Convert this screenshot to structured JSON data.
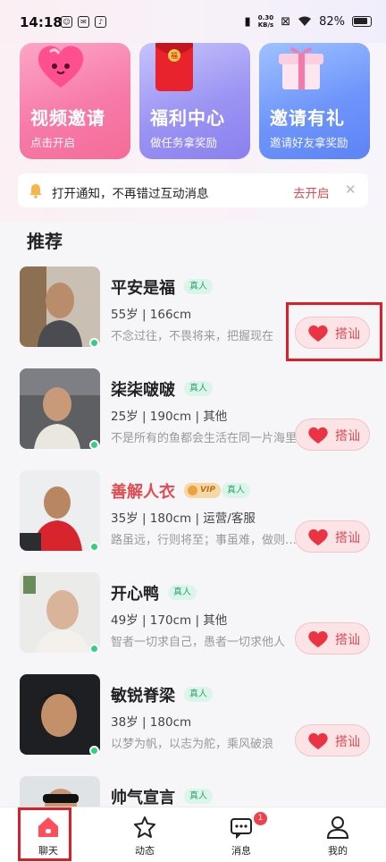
{
  "status_bar": {
    "time": "14:18",
    "net_speed_value": "0.30",
    "net_speed_unit": "KB/s",
    "battery": "82%"
  },
  "feature_cards": [
    {
      "title": "视频邀请",
      "subtitle": "点击开启"
    },
    {
      "title": "福利中心",
      "subtitle": "做任务拿奖励"
    },
    {
      "title": "邀请有礼",
      "subtitle": "邀请好友拿奖励"
    }
  ],
  "notice": {
    "text": "打开通知，不再错过互动消息",
    "action": "去开启",
    "close": "✕"
  },
  "section_title": "推荐",
  "verified_label": "真人",
  "vip_label": "VIP",
  "chat_button_label": "搭讪",
  "users": [
    {
      "name": "平安是福",
      "info": "55岁 | 166cm",
      "motto": "不念过往，不畏将来，把握现在",
      "vip": false
    },
    {
      "name": "柒柒啵啵",
      "info": "25岁 | 190cm | 其他",
      "motto": "不是所有的鱼都会生活在同一片海里",
      "vip": false
    },
    {
      "name": "善解人衣",
      "info": "35岁 | 180cm | 运营/客服",
      "motto": "路虽远，行则将至；事虽难，做则必成",
      "vip": true
    },
    {
      "name": "开心鸭",
      "info": "49岁 | 170cm | 其他",
      "motto": "智者一切求自己，愚者一切求他人",
      "vip": false
    },
    {
      "name": "敏锐脊梁",
      "info": "38岁 | 180cm",
      "motto": "以梦为帆，以志为舵，乘风破浪",
      "vip": false
    },
    {
      "name": "帅气宣言",
      "info": "",
      "motto": "",
      "vip": false
    }
  ],
  "tabs": [
    {
      "label": "聊天",
      "active": true
    },
    {
      "label": "动态",
      "active": false
    },
    {
      "label": "消息",
      "active": false,
      "badge": "1"
    },
    {
      "label": "我的",
      "active": false
    }
  ],
  "colors": {
    "accent_red": "#e24a52",
    "verified_green": "#2fa56d",
    "online_green": "#35d07f",
    "highlight_box": "#dd1d28"
  }
}
